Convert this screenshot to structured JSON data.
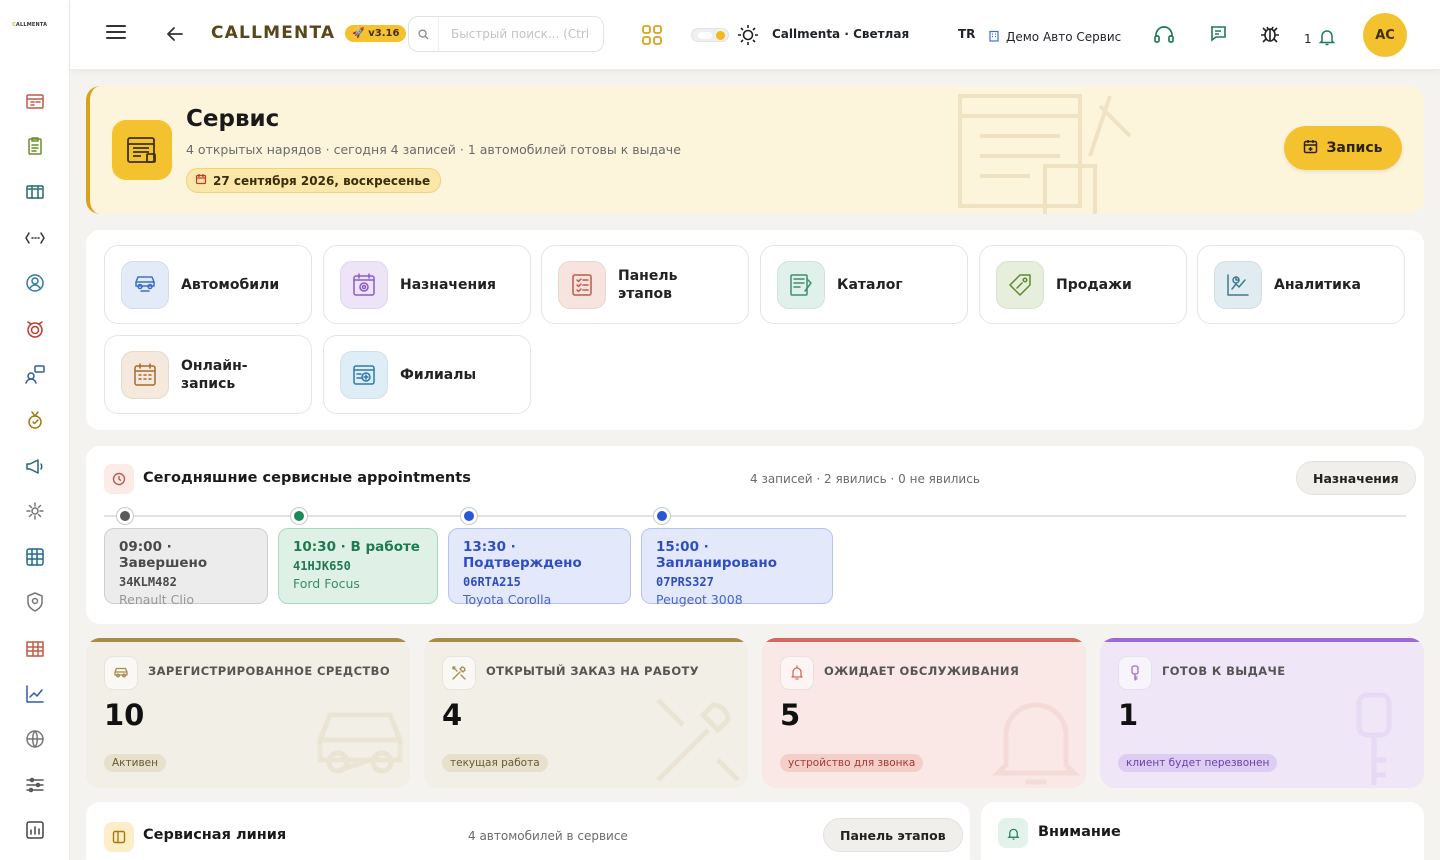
{
  "sidebar": {
    "logo_prefix": "C",
    "logo_text": "ALLMENTA",
    "items": [
      "dashboard-icon",
      "clipboard-icon",
      "kanban-icon",
      "code-icon",
      "user-circle-icon",
      "alarm-icon",
      "users-chat-icon",
      "medal-icon",
      "megaphone-icon",
      "gear-icon",
      "grid-icon",
      "shield-icon",
      "building-icon",
      "chart-line-icon",
      "globe-icon",
      "sliders-icon",
      "report-icon",
      "pyramid-icon"
    ]
  },
  "topbar": {
    "brand": "CALLMENTA",
    "version": "v3.16",
    "search_placeholder": "Быстрый поиск... (Ctrl+K)",
    "theme_label": "Callmenta · Светлая",
    "lang": "TR",
    "company": "Демо Авто Сервис",
    "notif_count": "1",
    "avatar_initials": "AC"
  },
  "hero": {
    "title": "Сервис",
    "subtitle": "4 открытых нарядов · сегодня 4 записей · 1 автомобилей готовы к выдаче",
    "date": "27 сентября 2026, воскресенье",
    "button": "Запись"
  },
  "modules": [
    {
      "label": "Автомобили",
      "icon": "car-icon",
      "bg": "#e3ebf8",
      "fg": "#3b6fd1"
    },
    {
      "label": "Назначения",
      "icon": "calendar-target-icon",
      "bg": "#eee4f8",
      "fg": "#8a5cc9"
    },
    {
      "label": "Панель этапов",
      "icon": "checklist-icon",
      "bg": "#f8e4df",
      "fg": "#c05a46"
    },
    {
      "label": "Каталог",
      "icon": "catalog-icon",
      "bg": "#e0f0ea",
      "fg": "#3f8f6e"
    },
    {
      "label": "Продажи",
      "icon": "tag-icon",
      "bg": "#e7efdc",
      "fg": "#5c8a2f"
    },
    {
      "label": "Аналитика",
      "icon": "analytics-icon",
      "bg": "#e1ecf0",
      "fg": "#3f7a8f"
    },
    {
      "label": "Онлайн-запись",
      "icon": "calendar-grid-icon",
      "bg": "#f5e8dc",
      "fg": "#a86a2c"
    },
    {
      "label": "Филиалы",
      "icon": "branch-icon",
      "bg": "#dfeef6",
      "fg": "#2e7aa8"
    }
  ],
  "appointments": {
    "title": "Сегодняшние сервисные appointments",
    "stats": "4 записей · 2 явились · 0 не явились",
    "button": "Назначения",
    "items": [
      {
        "time": "09:00 · Завершено",
        "plate": "34KLM482",
        "car": "Renault Clio",
        "status_color": "#5b5b5b",
        "bg": "#ececec",
        "border": "#cfcfcf",
        "text": "#4a4a4a",
        "dot": "#5a5a5a"
      },
      {
        "time": "10:30 · В работе",
        "plate": "41HJK650",
        "car": "Ford Focus",
        "status_color": "#1e7a4f",
        "bg": "#dff1e7",
        "border": "#a9d7bd",
        "text": "#1e7a4f",
        "dot": "#1b8a58"
      },
      {
        "time": "13:30 · Подтверждено",
        "plate": "06RTA215",
        "car": "Toyota Corolla",
        "status_color": "#2f4fc1",
        "bg": "#e3e8fb",
        "border": "#b8c4f0",
        "text": "#2f4fc1",
        "dot": "#2a56d8"
      },
      {
        "time": "15:00 · Запланировано",
        "plate": "07PRS327",
        "car": "Peugeot 3008",
        "status_color": "#2f4fc1",
        "bg": "#e3e8fb",
        "border": "#b8c4f0",
        "text": "#2f4fc1",
        "dot": "#2a56d8"
      }
    ]
  },
  "stats": [
    {
      "label": "ЗАРЕГИСТРИРОВАННОЕ СРЕДСТВО",
      "value": "10",
      "chip": "Активен",
      "bg": "#f2efe6",
      "top": "#a88a4a",
      "chip_bg": "#e6e0cd",
      "chip_fg": "#6a5a2c",
      "icon": "car-icon"
    },
    {
      "label": "ОТКРЫТЫЙ ЗАКАЗ НА РАБОТУ",
      "value": "4",
      "chip": "текущая работа",
      "bg": "#f2efe6",
      "top": "#a88a4a",
      "chip_bg": "#e6e0cd",
      "chip_fg": "#6a5a2c",
      "icon": "tools-icon"
    },
    {
      "label": "ОЖИДАЕТ ОБСЛУЖИВАНИЯ",
      "value": "5",
      "chip": "устройство для звонка",
      "bg": "#f9e8e6",
      "top": "#d06a5d",
      "chip_bg": "#f4cfca",
      "chip_fg": "#a33a2c",
      "icon": "bell-icon"
    },
    {
      "label": "ГОТОВ К ВЫДАЧЕ",
      "value": "1",
      "chip": "клиент будет перезвонен",
      "bg": "#efe7f8",
      "top": "#9a6ad8",
      "chip_bg": "#ddcdf2",
      "chip_fg": "#6a3fa8",
      "icon": "key-icon"
    }
  ],
  "service_line": {
    "title": "Сервисная линия",
    "sub": "4 автомобилей в сервисе",
    "button": "Панель этапов"
  },
  "attention": {
    "title": "Внимание"
  }
}
